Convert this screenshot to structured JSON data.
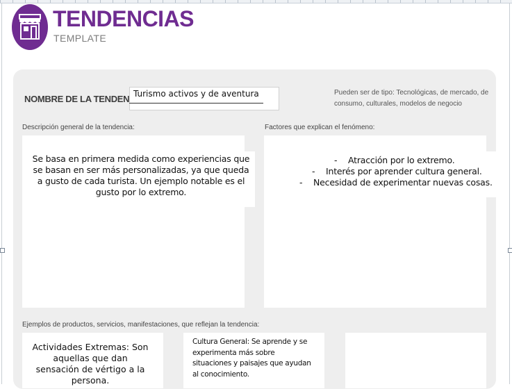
{
  "header": {
    "title": "TENDENCIAS",
    "subtitle": "TEMPLATE",
    "logo_icon": "storefront-icon",
    "brand_color": "#6f2c91"
  },
  "form": {
    "name_label": "NOMBRE DE LA TENDENCIA:",
    "name_value": "Turismo activos y de aventura",
    "type_hint": "Pueden ser de tipo: Tecnológicas, de mercado, de consumo, culturales, modelos de negocio",
    "description_label": "Descripción general de la tendencia:",
    "description_text": "Se basa en primera medida como experiencias que se basan en ser más personalizadas, ya que queda a gusto de cada turista. Un ejemplo notable es el gusto por lo extremo.",
    "factors_label": "Factores que explican el fenómeno:",
    "factors": [
      "Atracción por lo extremo.",
      "Interés por aprender cultura general.",
      "Necesidad de experimentar nuevas cosas."
    ],
    "examples_label": "Ejemplos de productos, servicios, manifestaciones, que reflejan la tendencia:",
    "examples": [
      "Actividades Extremas: Son aquellas que dan sensación de vértigo a la persona.",
      "Cultura General: Se aprende y se experimenta más sobre situaciones y paisajes que ayudan al conocimiento.",
      ""
    ],
    "panel_color": "#eeeeee"
  }
}
